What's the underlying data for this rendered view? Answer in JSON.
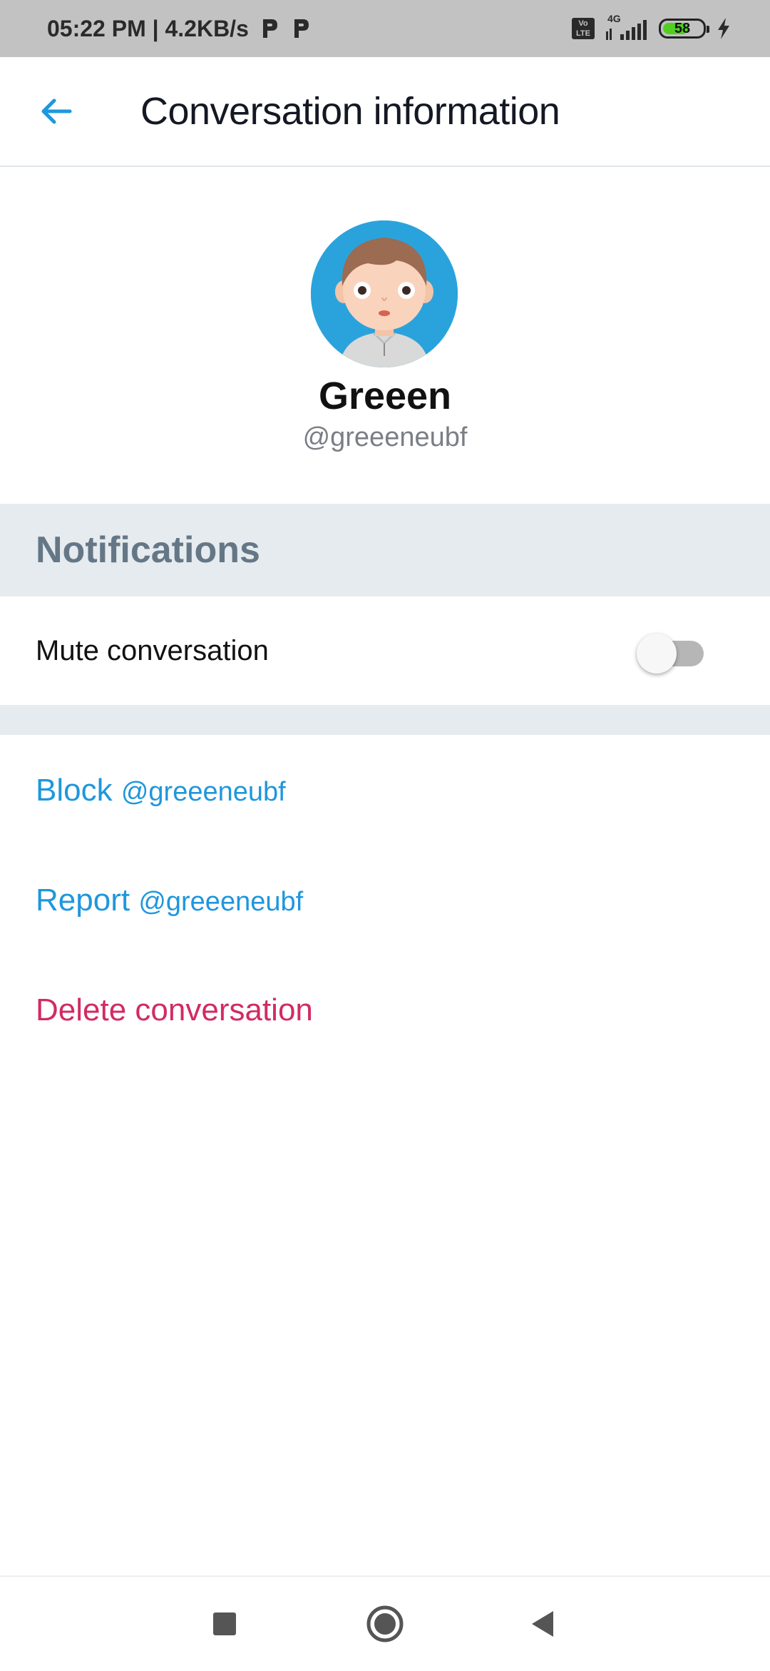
{
  "status_bar": {
    "time_speed": "05:22 PM | 4.2KB/s",
    "volte_top": "Vo",
    "volte_bottom": "LTE",
    "network": "4G",
    "battery": "58"
  },
  "app_bar": {
    "title": "Conversation information",
    "back_icon": "arrow-left-icon"
  },
  "profile": {
    "name": "Greeen",
    "handle": "@greeeneubf"
  },
  "notifications": {
    "header": "Notifications",
    "mute_label": "Mute conversation",
    "mute_enabled": false
  },
  "actions": {
    "block_word": "Block",
    "block_handle": "@greeeneubf",
    "report_word": "Report",
    "report_handle": "@greeeneubf",
    "delete": "Delete conversation"
  },
  "nav": {
    "recents_icon": "square-icon",
    "home_icon": "circle-icon",
    "back_icon": "triangle-back-icon"
  },
  "colors": {
    "accent": "#1f97dc",
    "danger": "#d12b63",
    "section_bg": "#e6ebef",
    "section_text": "#657786"
  }
}
